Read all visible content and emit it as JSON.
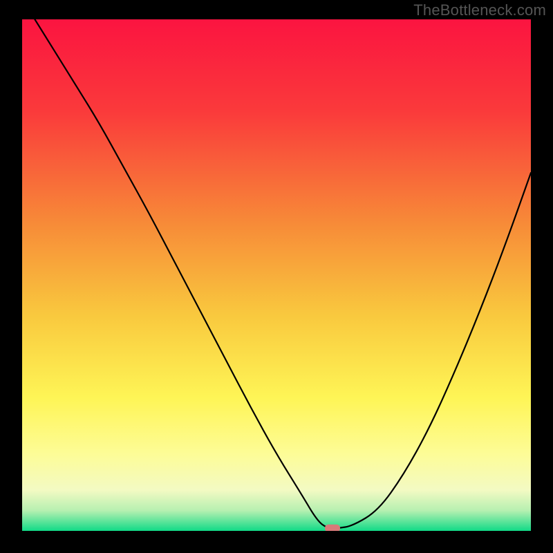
{
  "watermark": "TheBottleneck.com",
  "colors": {
    "black": "#000000",
    "red_top": "#fb1440",
    "orange_mid": "#f7a637",
    "yellow_low": "#fdfa64",
    "pale_yellow": "#fbfcb2",
    "pale_green": "#d6f6b7",
    "green_bottom": "#11da87",
    "curve": "#000000",
    "marker": "#d77a79"
  },
  "chart_data": {
    "type": "line",
    "title": "",
    "xlabel": "",
    "ylabel": "",
    "xlim": [
      0,
      100
    ],
    "ylim": [
      0,
      100
    ],
    "x": [
      0,
      5,
      10,
      15,
      20,
      25,
      30,
      35,
      40,
      45,
      50,
      55,
      58,
      60,
      62,
      65,
      70,
      75,
      80,
      85,
      90,
      95,
      100
    ],
    "values": [
      104,
      96,
      88,
      80,
      71,
      62,
      52.5,
      43,
      33.5,
      24,
      15,
      7,
      2,
      0.5,
      0.5,
      1,
      4,
      11,
      20,
      31,
      43,
      56,
      70
    ],
    "optimal_x": 61,
    "optimal_y": 0.5,
    "gradient_stops": [
      {
        "offset": 0.0,
        "color": "#fb1440"
      },
      {
        "offset": 0.18,
        "color": "#fa3a3b"
      },
      {
        "offset": 0.4,
        "color": "#f78b38"
      },
      {
        "offset": 0.58,
        "color": "#f9c93e"
      },
      {
        "offset": 0.74,
        "color": "#fef556"
      },
      {
        "offset": 0.85,
        "color": "#fdfc97"
      },
      {
        "offset": 0.92,
        "color": "#f3fac3"
      },
      {
        "offset": 0.96,
        "color": "#b7f0b1"
      },
      {
        "offset": 1.0,
        "color": "#11da87"
      }
    ]
  }
}
